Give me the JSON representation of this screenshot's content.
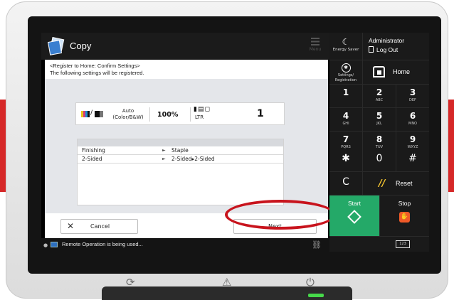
{
  "app": {
    "title": "Copy",
    "menu_label": "Menu",
    "header_line1": "<Register to Home: Confirm Settings>",
    "header_line2": "The following settings will be registered."
  },
  "summary": {
    "color_mode": "Auto\n(Color/B&W)",
    "zoom": "100%",
    "paper": "LTR",
    "copies": "1"
  },
  "settings_table": {
    "rows": [
      {
        "name": "Finishing",
        "value": "Staple"
      },
      {
        "name": "2-Sided",
        "value": "2-Sided▸2-Sided"
      }
    ]
  },
  "buttons": {
    "cancel": "Cancel",
    "next": "Next"
  },
  "status": {
    "text": "Remote Operation is being used..."
  },
  "right_panel": {
    "energy_saver": "Energy Saver",
    "user": "Administrator",
    "logout": "Log Out",
    "settings_line1": "Settings/",
    "settings_line2": "Registration",
    "home": "Home",
    "keys": [
      {
        "num": "1",
        "sub": ""
      },
      {
        "num": "2",
        "sub": "ABC"
      },
      {
        "num": "3",
        "sub": "DEF"
      },
      {
        "num": "4",
        "sub": "GHI"
      },
      {
        "num": "5",
        "sub": "JKL"
      },
      {
        "num": "6",
        "sub": "MNO"
      },
      {
        "num": "7",
        "sub": "PQRS"
      },
      {
        "num": "8",
        "sub": "TUV"
      },
      {
        "num": "9",
        "sub": "WXYZ"
      }
    ],
    "star": "✱",
    "zero": "0",
    "hash": "#",
    "clear": "C",
    "reset": "Reset",
    "start": "Start",
    "stop": "Stop",
    "counter": "123"
  },
  "colors": {
    "start_green": "#24a968",
    "stop_orange": "#f05a28",
    "highlight_red": "#c8141d",
    "reset_yellow": "#f4c430"
  },
  "icons": [
    "copy-icon",
    "menu-icon",
    "moon-icon",
    "logout-icon",
    "settings-icon",
    "home-icon",
    "reset-icon",
    "start-icon",
    "stop-icon",
    "counter-icon",
    "monitor-icon",
    "network-icon"
  ]
}
